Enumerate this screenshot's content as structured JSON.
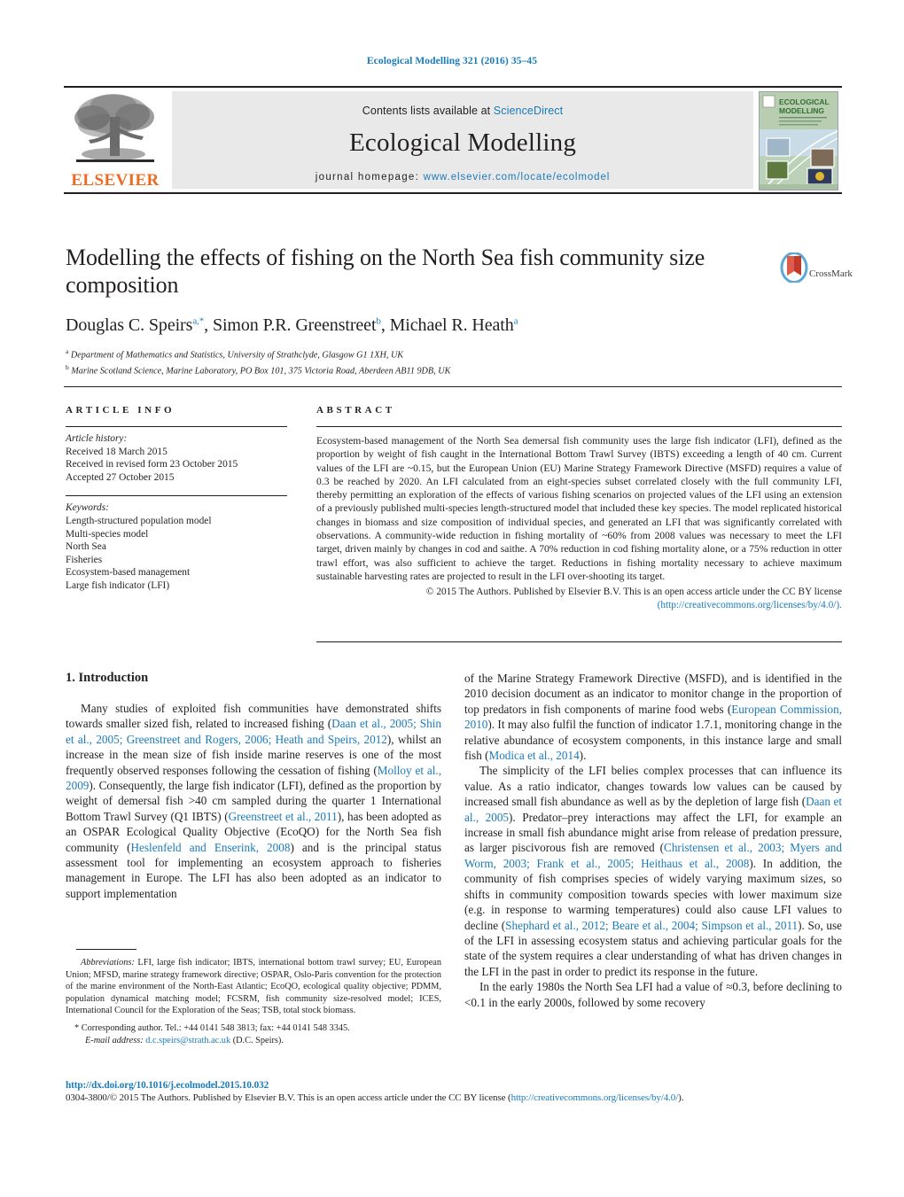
{
  "running_head": "Ecological Modelling 321 (2016) 35–45",
  "masthead": {
    "contents_prefix": "Contents lists available at ",
    "sciencedirect": "ScienceDirect",
    "journal_title": "Ecological Modelling",
    "homepage_label": "journal homepage: ",
    "homepage_url": "www.elsevier.com/locate/ecolmodel",
    "publisher": "ELSEVIER",
    "cover_line1": "ECOLOGICAL",
    "cover_line2": "MODELLING"
  },
  "article": {
    "title": "Modelling the effects of fishing on the North Sea fish community size composition",
    "authors_html": "Douglas C. Speirs<sup>a,*</sup>, Simon P.R. Greenstreet<sup>b</sup>, Michael R. Heath<sup>a</sup>",
    "affiliation_a": "Department of Mathematics and Statistics, University of Strathclyde, Glasgow G1 1XH, UK",
    "affiliation_b": "Marine Scotland Science, Marine Laboratory, PO Box 101, 375 Victoria Road, Aberdeen AB11 9DB, UK",
    "crossmark_label": "CrossMark"
  },
  "info": {
    "heading": "ARTICLE INFO",
    "history_label": "Article history:",
    "history": [
      "Received 18 March 2015",
      "Received in revised form 23 October 2015",
      "Accepted 27 October 2015"
    ],
    "keywords_label": "Keywords:",
    "keywords": [
      "Length-structured population model",
      "Multi-species model",
      "North Sea",
      "Fisheries",
      "Ecosystem-based management",
      "Large fish indicator (LFI)"
    ]
  },
  "abstract": {
    "heading": "ABSTRACT",
    "text": "Ecosystem-based management of the North Sea demersal fish community uses the large fish indicator (LFI), defined as the proportion by weight of fish caught in the International Bottom Trawl Survey (IBTS) exceeding a length of 40 cm. Current values of the LFI are ~0.15, but the European Union (EU) Marine Strategy Framework Directive (MSFD) requires a value of 0.3 be reached by 2020. An LFI calculated from an eight-species subset correlated closely with the full community LFI, thereby permitting an exploration of the effects of various fishing scenarios on projected values of the LFI using an extension of a previously published multi-species length-structured model that included these key species. The model replicated historical changes in biomass and size composition of individual species, and generated an LFI that was significantly correlated with observations. A community-wide reduction in fishing mortality of ~60% from 2008 values was necessary to meet the LFI target, driven mainly by changes in cod and saithe. A 70% reduction in cod fishing mortality alone, or a 75% reduction in otter trawl effort, was also sufficient to achieve the target. Reductions in fishing mortality necessary to achieve maximum sustainable harvesting rates are projected to result in the LFI over-shooting its target.",
    "copyright": "© 2015 The Authors. Published by Elsevier B.V. This is an open access article under the CC BY license",
    "license_url": "(http://creativecommons.org/licenses/by/4.0/)."
  },
  "body": {
    "section1_title": "1.  Introduction",
    "left_paragraphs": [
      "Many studies of exploited fish communities have demonstrated shifts towards smaller sized fish, related to increased fishing (Daan et al., 2005; Shin et al., 2005; Greenstreet and Rogers, 2006; Heath and Speirs, 2012), whilst an increase in the mean size of fish inside marine reserves is one of the most frequently observed responses following the cessation of fishing (Molloy et al., 2009). Consequently, the large fish indicator (LFI), defined as the proportion by weight of demersal fish >40 cm sampled during the quarter 1 International Bottom Trawl Survey (Q1 IBTS) (Greenstreet et al., 2011), has been adopted as an OSPAR Ecological Quality Objective (EcoQO) for the North Sea fish community (Heslenfeld and Enserink, 2008) and is the principal status assessment tool for implementing an ecosystem approach to fisheries management in Europe. The LFI has also been adopted as an indicator to support implementation"
    ],
    "right_paragraphs": [
      "of the Marine Strategy Framework Directive (MSFD), and is identified in the 2010 decision document as an indicator to monitor change in the proportion of top predators in fish components of marine food webs (European Commission, 2010). It may also fulfil the function of indicator 1.7.1, monitoring change in the relative abundance of ecosystem components, in this instance large and small fish (Modica et al., 2014).",
      "The simplicity of the LFI belies complex processes that can influence its value. As a ratio indicator, changes towards low values can be caused by increased small fish abundance as well as by the depletion of large fish (Daan et al., 2005). Predator–prey interactions may affect the LFI, for example an increase in small fish abundance might arise from release of predation pressure, as larger piscivorous fish are removed (Christensen et al., 2003; Myers and Worm, 2003; Frank et al., 2005; Heithaus et al., 2008). In addition, the community of fish comprises species of widely varying maximum sizes, so shifts in community composition towards species with lower maximum size (e.g. in response to warming temperatures) could also cause LFI values to decline (Shephard et al., 2012; Beare et al., 2004; Simpson et al., 2011). So, use of the LFI in assessing ecosystem status and achieving particular goals for the state of the system requires a clear understanding of what has driven changes in the LFI in the past in order to predict its response in the future.",
      "In the early 1980s the North Sea LFI had a value of ≈0.3, before declining to <0.1 in the early 2000s, followed by some recovery"
    ]
  },
  "footnotes": {
    "abbreviations_label": "Abbreviations:",
    "abbreviations_text": "LFI, large fish indicator; IBTS, international bottom trawl survey; EU, European Union; MFSD, marine strategy framework directive; OSPAR, Oslo-Paris convention for the protection of the marine environment of the North-East Atlantic; EcoQO, ecological quality objective; PDMM, population dynamical matching model; FCSRM, fish community size-resolved model; ICES, International Council for the Exploration of the Seas; TSB, total stock biomass.",
    "corresponding": "* Corresponding author. Tel.: +44 0141 548 3813; fax: +44 0141 548 3345.",
    "email_label": "E-mail address:",
    "email": "d.c.speirs@strath.ac.uk",
    "email_suffix": "(D.C. Speirs)."
  },
  "footer": {
    "doi": "http://dx.doi.org/10.1016/j.ecolmodel.2015.10.032",
    "issn_text": "0304-3800/© 2015 The Authors. Published by Elsevier B.V. This is an open access article under the CC BY license (",
    "issn_license_url": "http://creativecommons.org/licenses/by/4.0/",
    "issn_tail": ")."
  },
  "colors": {
    "link": "#1a7bb9",
    "elsevier_orange": "#eb6b23",
    "rule": "#231f20"
  }
}
